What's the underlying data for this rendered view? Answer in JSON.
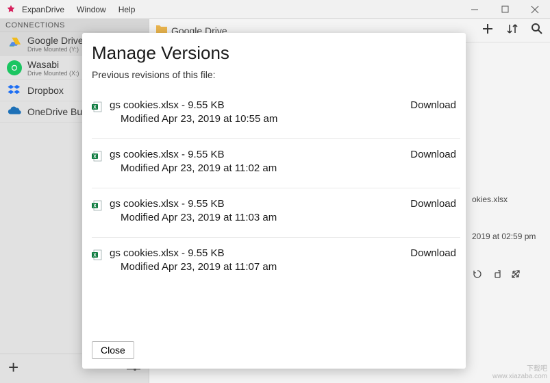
{
  "titlebar": {
    "app": "ExpanDrive",
    "menu": [
      "Window",
      "Help"
    ]
  },
  "sidebar": {
    "header": "CONNECTIONS",
    "items": [
      {
        "name": "Google Drive",
        "sub": "Drive Mounted (Y:)"
      },
      {
        "name": "Wasabi",
        "sub": "Drive Mounted (X:)"
      },
      {
        "name": "Dropbox",
        "sub": ""
      },
      {
        "name": "OneDrive Business",
        "sub": ""
      }
    ]
  },
  "main": {
    "path": "Google Drive",
    "detail": {
      "filename": "okies.xlsx",
      "date": "2019 at 02:59 pm"
    }
  },
  "modal": {
    "title": "Manage Versions",
    "subtitle": "Previous revisions of this file:",
    "download_label": "Download",
    "close_label": "Close",
    "versions": [
      {
        "file": "gs cookies.xlsx",
        "size": "9.55 KB",
        "modified": "Modified Apr 23, 2019 at 10:55 am"
      },
      {
        "file": "gs cookies.xlsx",
        "size": "9.55 KB",
        "modified": "Modified Apr 23, 2019 at 11:02 am"
      },
      {
        "file": "gs cookies.xlsx",
        "size": "9.55 KB",
        "modified": "Modified Apr 23, 2019 at 11:03 am"
      },
      {
        "file": "gs cookies.xlsx",
        "size": "9.55 KB",
        "modified": "Modified Apr 23, 2019 at 11:07 am"
      }
    ]
  },
  "watermark": [
    "下载吧",
    "www.xiazaba.com"
  ]
}
